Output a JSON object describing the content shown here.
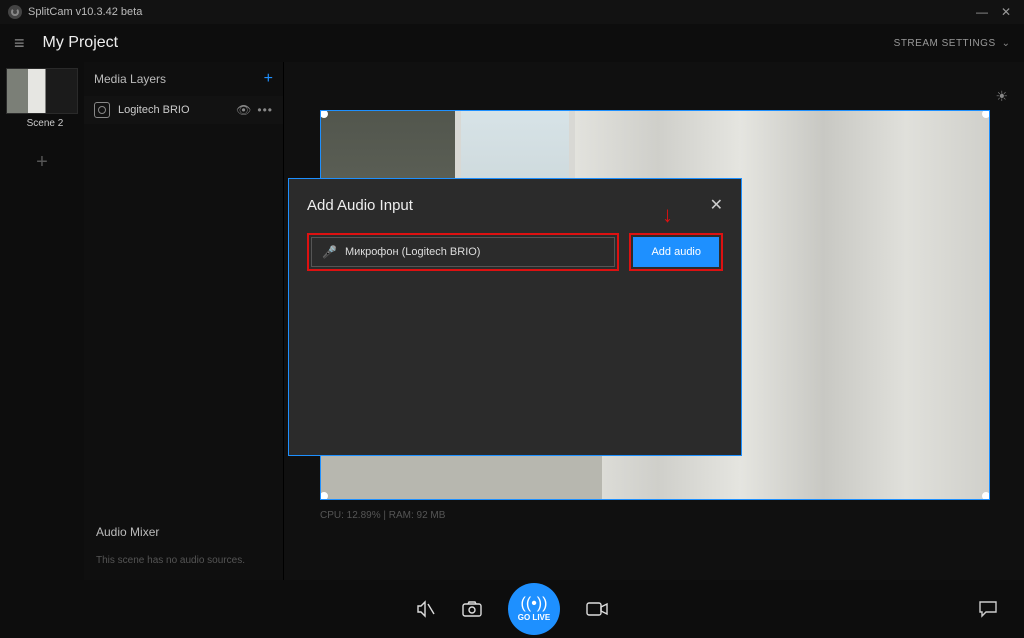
{
  "titlebar": {
    "app_name": "SplitCam v10.3.42 beta"
  },
  "header": {
    "project_title": "My Project",
    "stream_settings_label": "STREAM SETTINGS"
  },
  "scenes": {
    "items": [
      {
        "label": "Scene 2"
      }
    ]
  },
  "layers": {
    "heading": "Media Layers",
    "items": [
      {
        "label": "Logitech BRIO",
        "icon": "camera-icon"
      }
    ]
  },
  "audio_mixer": {
    "heading": "Audio Mixer",
    "empty_text": "This scene has no audio sources."
  },
  "status": {
    "text": "CPU: 12.89% | RAM: 92 MB"
  },
  "bottom": {
    "golive_label": "GO LIVE"
  },
  "modal": {
    "title": "Add Audio Input",
    "input_value": "Микрофон (Logitech BRIO)",
    "add_button_label": "Add audio"
  },
  "colors": {
    "accent": "#1e90ff",
    "highlight_annotation": "#d11"
  }
}
